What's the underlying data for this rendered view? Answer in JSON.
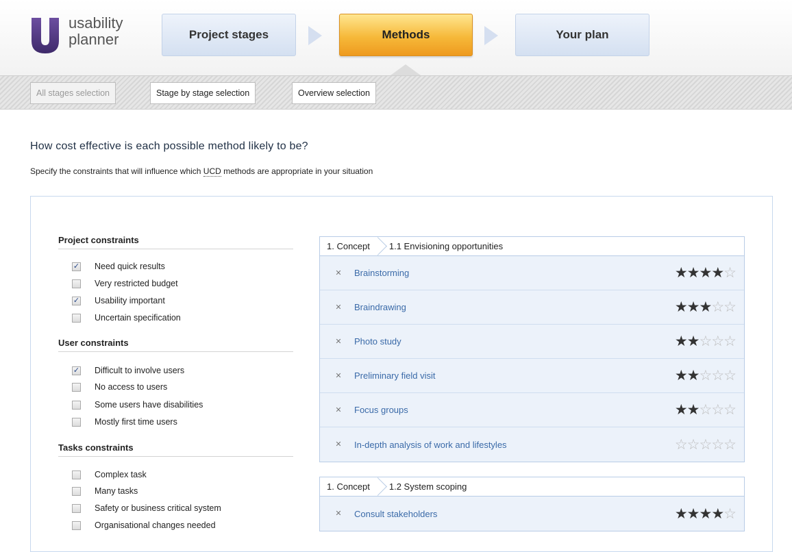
{
  "brand": {
    "line1": "usability",
    "line2": "planner",
    "color": "#5a3f8a"
  },
  "steps": [
    {
      "label": "Project stages",
      "active": false
    },
    {
      "label": "Methods",
      "active": true
    },
    {
      "label": "Your plan",
      "active": false
    }
  ],
  "tabs": [
    {
      "label": "All stages selection",
      "disabled": true
    },
    {
      "label": "Stage by stage selection",
      "disabled": false
    },
    {
      "label": "Overview selection",
      "disabled": false
    }
  ],
  "page": {
    "title": "How cost effective is each possible method likely to be?",
    "subtitle_before": "Specify the constraints that will influence which ",
    "subtitle_abbr": "UCD",
    "subtitle_after": " methods are appropriate in your situation"
  },
  "constraints": [
    {
      "title": "Project constraints",
      "items": [
        {
          "label": "Need quick results",
          "checked": true
        },
        {
          "label": "Very restricted budget",
          "checked": false
        },
        {
          "label": "Usability important",
          "checked": true
        },
        {
          "label": "Uncertain specification",
          "checked": false
        }
      ]
    },
    {
      "title": "User constraints",
      "items": [
        {
          "label": "Difficult to involve users",
          "checked": true
        },
        {
          "label": "No access to users",
          "checked": false
        },
        {
          "label": "Some users have disabilities",
          "checked": false
        },
        {
          "label": "Mostly first time users",
          "checked": false
        }
      ]
    },
    {
      "title": "Tasks constraints",
      "items": [
        {
          "label": "Complex task",
          "checked": false
        },
        {
          "label": "Many tasks",
          "checked": false
        },
        {
          "label": "Safety or business critical system",
          "checked": false
        },
        {
          "label": "Organisational changes needed",
          "checked": false
        }
      ]
    }
  ],
  "method_groups": [
    {
      "stage": "1. Concept",
      "substage": "1.1 Envisioning opportunities",
      "methods": [
        {
          "name": "Brainstorming",
          "rating": 4
        },
        {
          "name": "Braindrawing",
          "rating": 3
        },
        {
          "name": "Photo study",
          "rating": 2
        },
        {
          "name": "Preliminary field visit",
          "rating": 2
        },
        {
          "name": "Focus groups",
          "rating": 2
        },
        {
          "name": "In-depth analysis of work and lifestyles",
          "rating": 0
        }
      ]
    },
    {
      "stage": "1. Concept",
      "substage": "1.2 System scoping",
      "methods": [
        {
          "name": "Consult stakeholders",
          "rating": 4
        }
      ]
    }
  ],
  "rating_max": 5,
  "icons": {
    "remove": "close-icon",
    "check": "checkmark-icon",
    "star": "star-icon"
  }
}
